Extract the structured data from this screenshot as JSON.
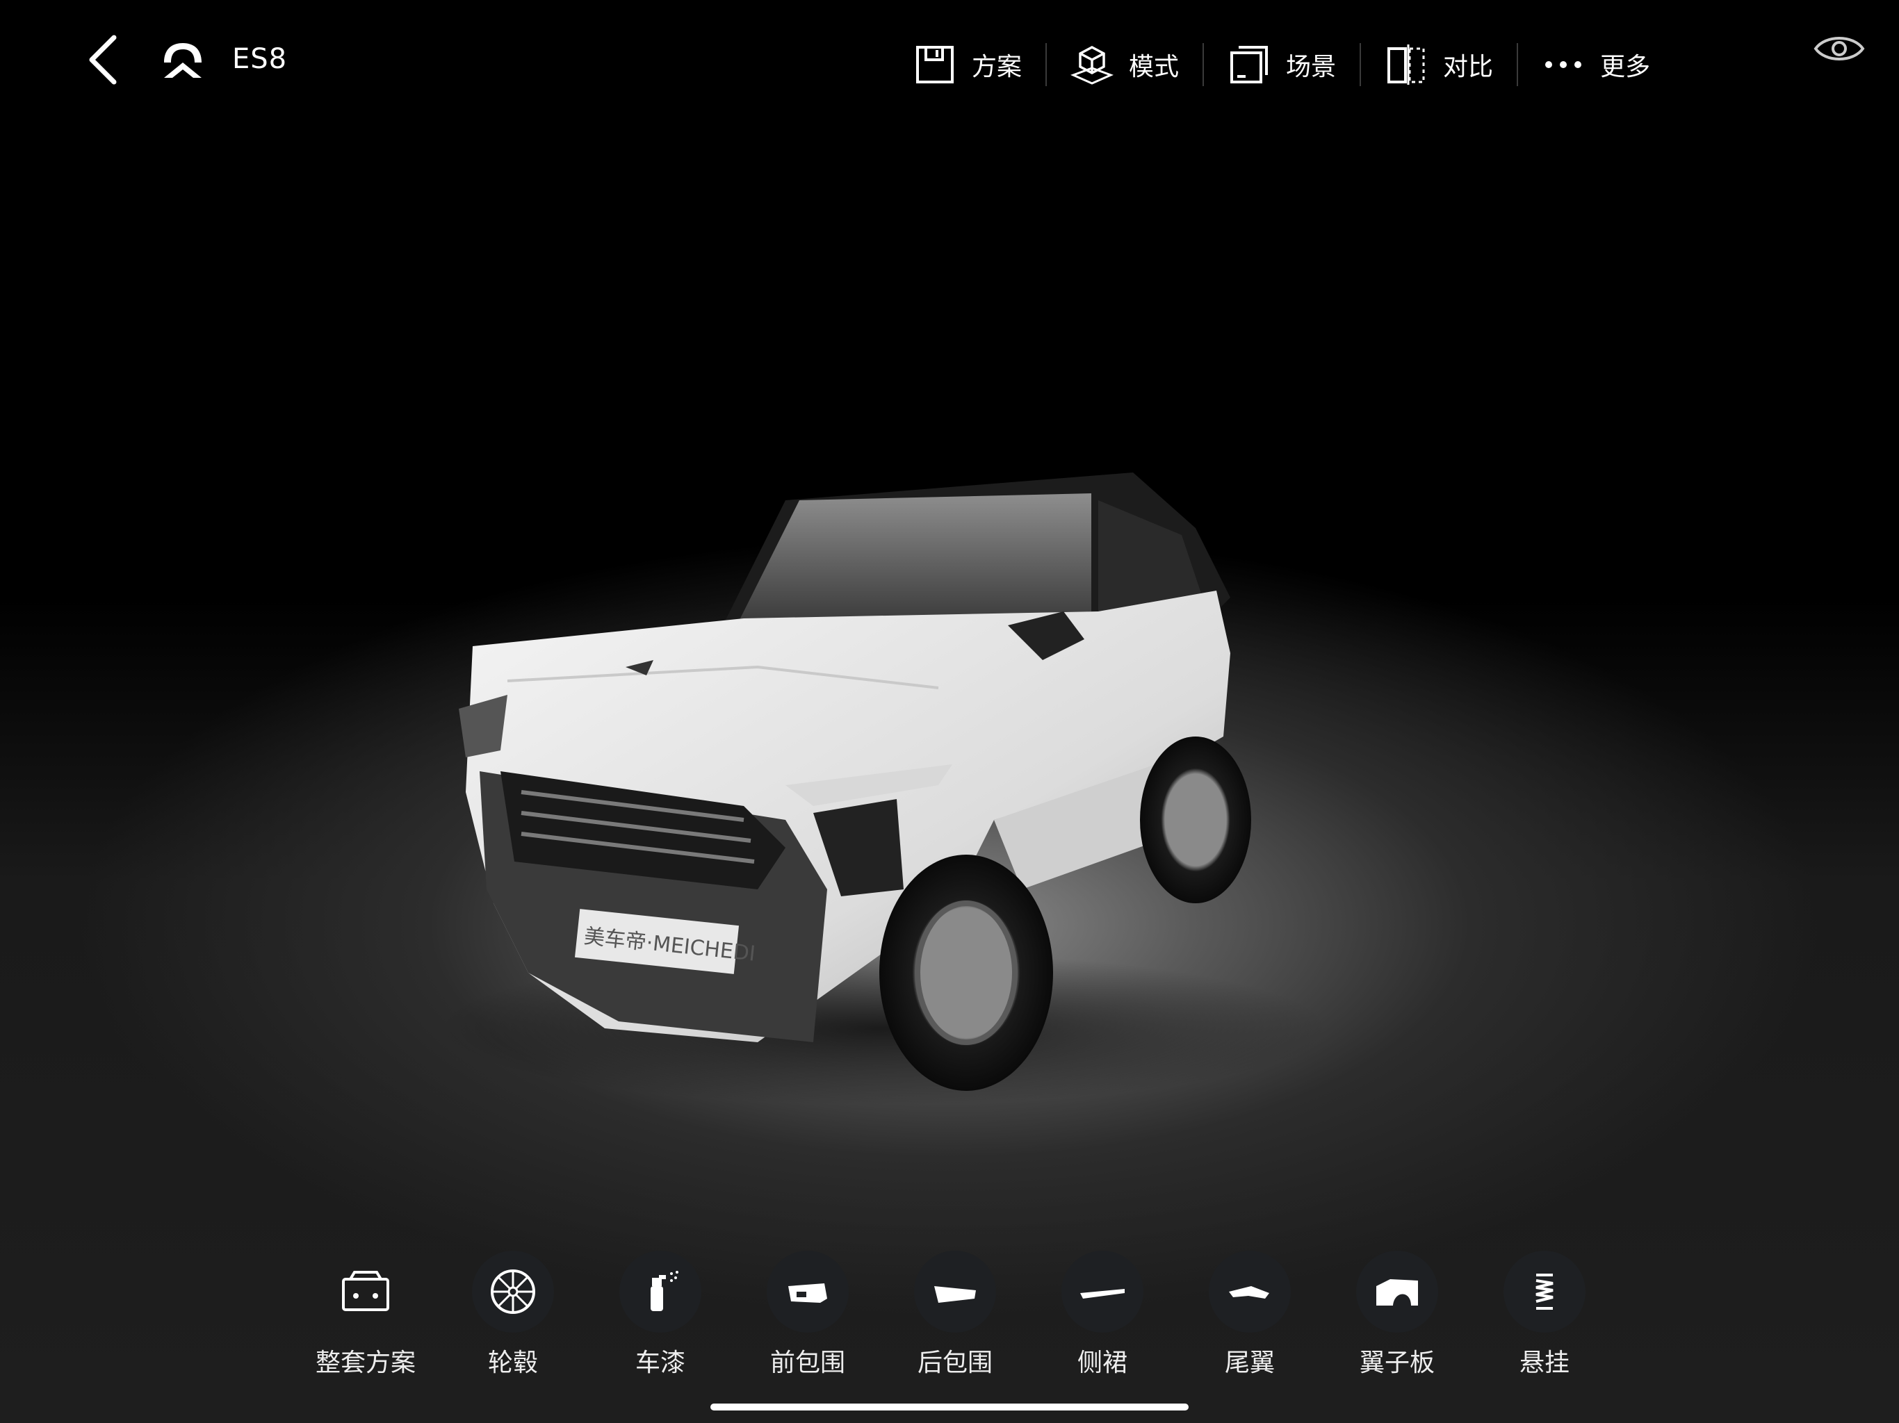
{
  "header": {
    "title": "ES8",
    "back_icon": "chevron-left-icon",
    "brand_icon": "nio-logo"
  },
  "toolbar": {
    "items": [
      {
        "label": "方案",
        "icon": "save-icon"
      },
      {
        "label": "模式",
        "icon": "cube-icon"
      },
      {
        "label": "场景",
        "icon": "scene-icon"
      },
      {
        "label": "对比",
        "icon": "compare-icon"
      },
      {
        "label": "更多",
        "icon": "more-icon"
      }
    ],
    "eye_icon": "eye-icon"
  },
  "car": {
    "plate_text": "美车帝·MEICHEDI"
  },
  "bottom_nav": {
    "items": [
      {
        "label": "整套方案",
        "icon": "package-icon"
      },
      {
        "label": "轮毂",
        "icon": "wheel-icon"
      },
      {
        "label": "车漆",
        "icon": "spray-icon"
      },
      {
        "label": "前包围",
        "icon": "front-bumper-icon"
      },
      {
        "label": "后包围",
        "icon": "rear-bumper-icon"
      },
      {
        "label": "侧裙",
        "icon": "side-skirt-icon"
      },
      {
        "label": "尾翼",
        "icon": "spoiler-icon"
      },
      {
        "label": "翼子板",
        "icon": "fender-icon"
      },
      {
        "label": "悬挂",
        "icon": "suspension-icon"
      }
    ]
  },
  "colors": {
    "background": "#000000",
    "car_body": "#eeeeee",
    "nav_icon_bg": "#1e2023"
  }
}
